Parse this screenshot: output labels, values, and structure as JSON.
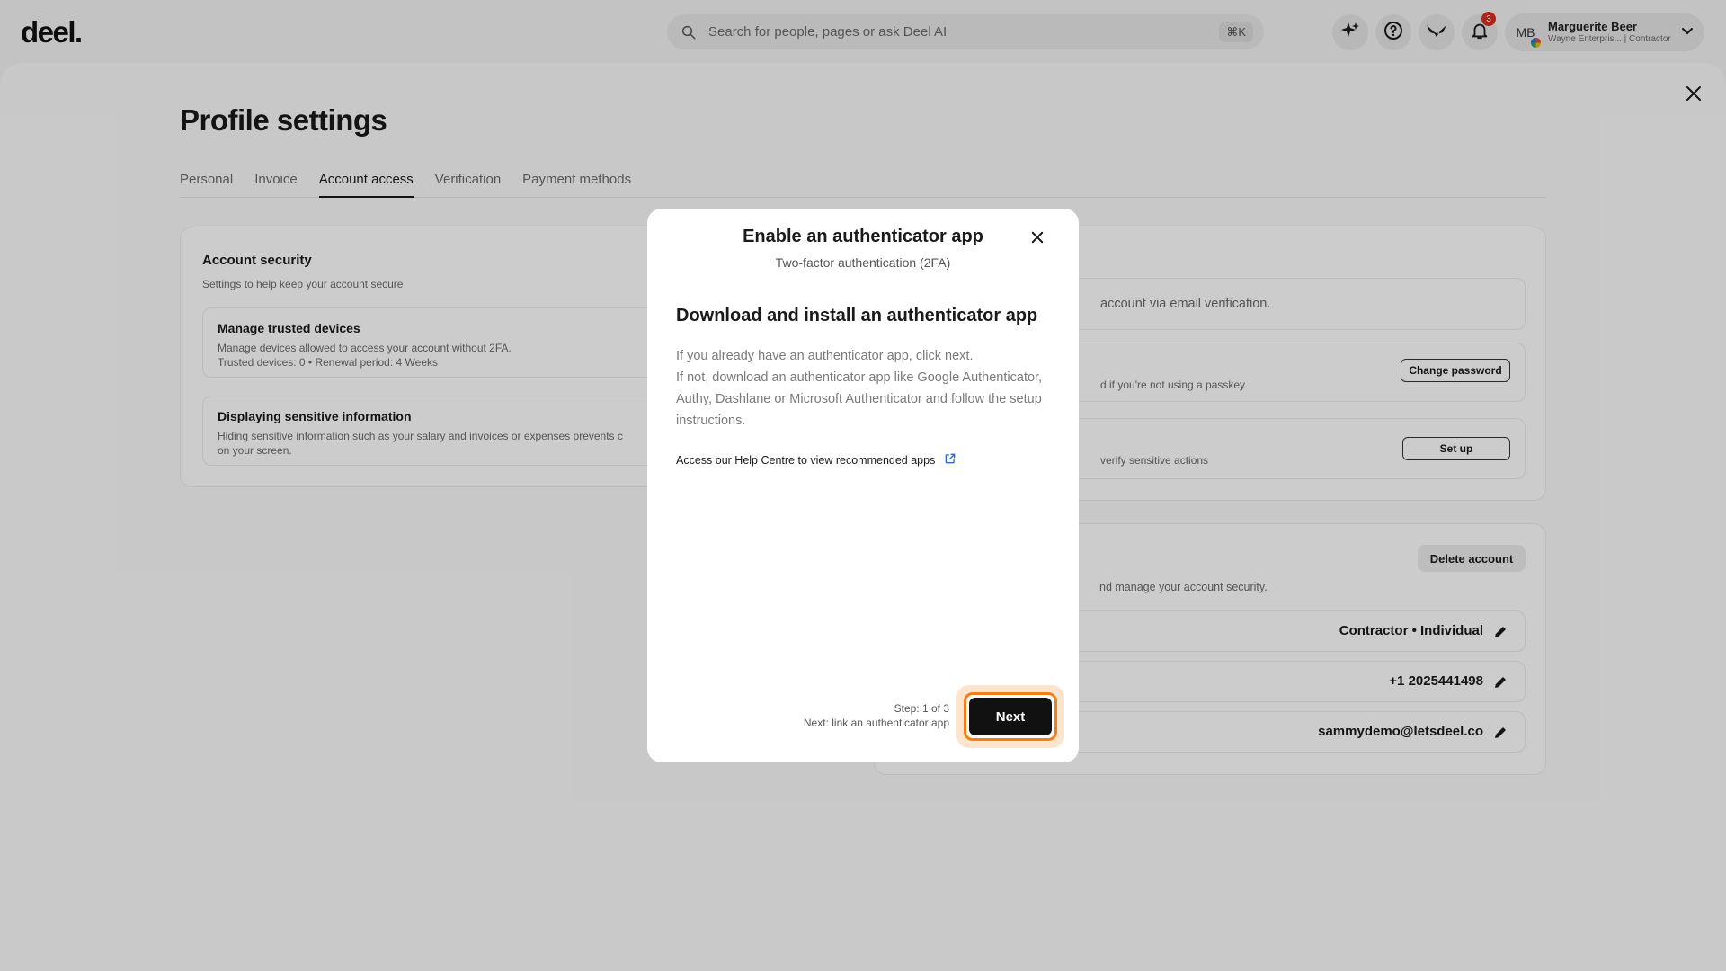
{
  "app": {
    "logo": "deel."
  },
  "search": {
    "placeholder": "Search for people, pages or ask Deel AI",
    "shortcut": "⌘K"
  },
  "header": {
    "notifications_count": "3",
    "profile": {
      "initials": "MB",
      "name": "Marguerite Beer",
      "subtitle": "Wayne Enterpris... | Contractor"
    }
  },
  "page": {
    "title": "Profile settings",
    "tabs": [
      {
        "label": "Personal",
        "active": false
      },
      {
        "label": "Invoice",
        "active": false
      },
      {
        "label": "Account access",
        "active": true
      },
      {
        "label": "Verification",
        "active": false
      },
      {
        "label": "Payment methods",
        "active": false
      }
    ]
  },
  "account_security": {
    "title": "Account security",
    "subtitle": "Settings to help keep your account secure",
    "trusted_devices": {
      "title": "Manage trusted devices",
      "desc": "Manage devices allowed to access your account without 2FA.",
      "meta": "Trusted devices: 0 • Renewal period: 4 Weeks"
    },
    "sensitive_info": {
      "title": "Displaying sensitive information",
      "desc_line1": "Hiding sensitive information such as your salary and invoices or expenses prevents c",
      "desc_line2": "on your screen."
    }
  },
  "login_methods": {
    "email_text": "account via email verification.",
    "password_text": "d if you're not using a passkey",
    "change_password_label": "Change password",
    "twofa_text": "verify sensitive actions",
    "setup_label": "Set up"
  },
  "account_details": {
    "delete_label": "Delete account",
    "desc": "nd manage your account security.",
    "account_type": "Contractor • Individual",
    "phone": "+1 2025441498",
    "email": "sammydemo@letsdeel.co"
  },
  "modal": {
    "title": "Enable an authenticator app",
    "subtitle": "Two-factor authentication (2FA)",
    "heading": "Download and install an authenticator app",
    "body_line1": "If you already have an authenticator app, click next.",
    "body_line2": "If not, download an authenticator app like Google Authenticator, Authy, Dashlane or Microsoft Authenticator and follow the setup instructions.",
    "help_link": "Access our Help Centre to view recommended apps",
    "step": "Step: 1 of 3",
    "next_step": "Next: link an authenticator app",
    "next_label": "Next"
  }
}
